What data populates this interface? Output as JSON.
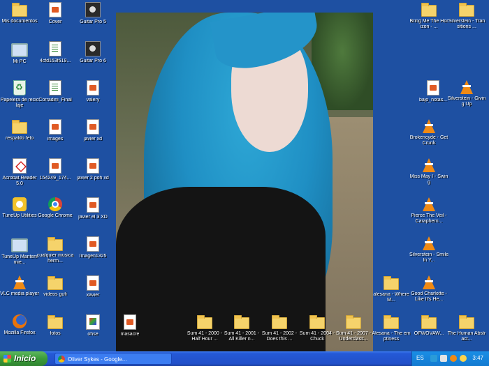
{
  "desktop": {
    "icons": [
      {
        "label": "Mis documentos",
        "type": "folder"
      },
      {
        "label": "Cover",
        "type": "media"
      },
      {
        "label": "Guitar Pro 5",
        "type": "guitar"
      },
      {
        "label": "Mi PC",
        "type": "pc"
      },
      {
        "label": "4cfd163f619...",
        "type": "doc"
      },
      {
        "label": "Guitar Pro 6",
        "type": "guitar"
      },
      {
        "label": "Papelera de reciclaje",
        "type": "bin"
      },
      {
        "label": "Corradini_Final",
        "type": "doc"
      },
      {
        "label": "valery",
        "type": "media"
      },
      {
        "label": "respaldo felo",
        "type": "folder"
      },
      {
        "label": "images",
        "type": "media"
      },
      {
        "label": "javier xd",
        "type": "media"
      },
      {
        "label": "Acrobat Reader 5.0",
        "type": "pdf"
      },
      {
        "label": "154249_174...",
        "type": "media"
      },
      {
        "label": "javier 2 poh xd",
        "type": "media"
      },
      {
        "label": "TuneUp Utilities",
        "type": "tune"
      },
      {
        "label": "Google Chrome",
        "type": "chrome"
      },
      {
        "label": "javier el 3 XD",
        "type": "media"
      },
      {
        "label": "TuneUp Mantenimie...",
        "type": "pc"
      },
      {
        "label": "cualquier musica herm...",
        "type": "folder"
      },
      {
        "label": "Imagen1325",
        "type": "media"
      },
      {
        "label": "VLC media player",
        "type": "cone"
      },
      {
        "label": "videos gufi",
        "type": "folder"
      },
      {
        "label": "xavier",
        "type": "media"
      },
      {
        "label": "Mozilla Firefox",
        "type": "firefox"
      },
      {
        "label": "fotos",
        "type": "folder"
      },
      {
        "label": "ohse",
        "type": "paint"
      },
      {
        "label": "masacre",
        "type": "media"
      },
      {
        "label": "Sum 41 - 2000 - Half Hour ...",
        "type": "folder"
      },
      {
        "label": "Sum 41 - 2001 - All Killer n...",
        "type": "folder"
      },
      {
        "label": "Sum 41 - 2002 - Does this ...",
        "type": "folder"
      },
      {
        "label": "Sum 41 - 2004 - Chuck",
        "type": "folder"
      },
      {
        "label": "Sum 41 - 2007 - Underclass...",
        "type": "folder"
      },
      {
        "label": "alesana - Where M...",
        "type": "folder"
      },
      {
        "label": "Alesana - The emptiness",
        "type": "folder"
      },
      {
        "label": "Good Charlotte - Like It's He...",
        "type": "cone"
      },
      {
        "label": "OFWOVAW...",
        "type": "folder"
      },
      {
        "label": "The Human Abstract...",
        "type": "folder"
      },
      {
        "label": "Bring Me The Horizon - ...",
        "type": "folder"
      },
      {
        "label": "Silverstein - Transitions ...",
        "type": "folder"
      },
      {
        "label": "bajo_notas...",
        "type": "media"
      },
      {
        "label": "Silverstein - Giving Up",
        "type": "cone"
      },
      {
        "label": "Brokencyde - Get Crunk",
        "type": "cone"
      },
      {
        "label": "Miss May I - Swing",
        "type": "cone"
      },
      {
        "label": "Pierce The Veil - Caraphern...",
        "type": "cone"
      },
      {
        "label": "Silverstein - Smile In Y...",
        "type": "cone"
      }
    ]
  },
  "taskbar": {
    "start_label": "Inicio",
    "task_label": "Oliver Sykes - Google...",
    "language": "ES",
    "clock": "3:47"
  }
}
